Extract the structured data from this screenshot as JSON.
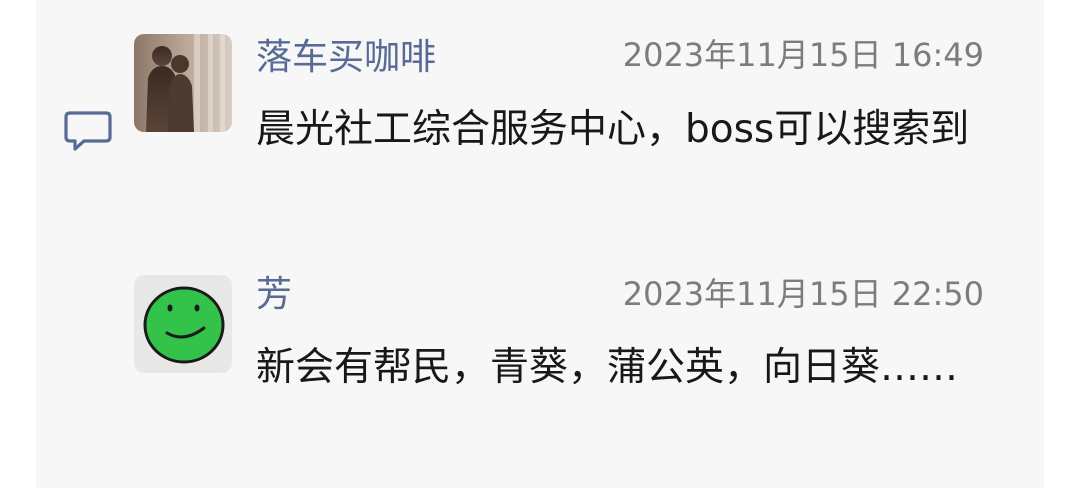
{
  "comments": [
    {
      "author": "落车买咖啡",
      "timestamp": "2023年11月15日 16:49",
      "text": "晨光社工综合服务中心，boss可以搜索到",
      "avatar": "photo-avatar"
    },
    {
      "author": "芳",
      "timestamp": "2023年11月15日 22:50",
      "text": "新会有帮民，青葵，蒲公英，向日葵……",
      "avatar": "green-smiley-avatar"
    }
  ],
  "icons": {
    "comment": "comment-bubble-icon"
  },
  "colors": {
    "author_name": "#576b95",
    "timestamp": "#7c7c7c",
    "body_text": "#181818",
    "panel_bg": "#f7f7f7",
    "icon": "#576b95"
  }
}
